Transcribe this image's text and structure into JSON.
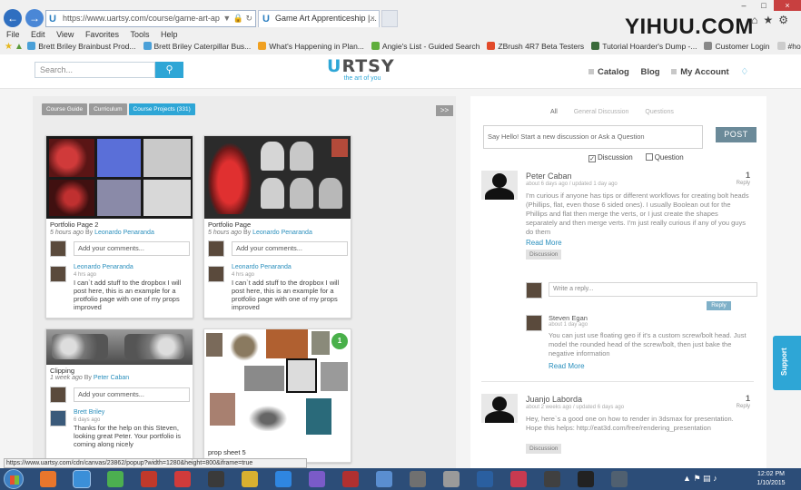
{
  "browser": {
    "address_url": "https://www.uartsy.com/course/game-art-ap",
    "tab_title": "Game Art Apprenticeship |...",
    "watermark": "YIHUU.COM",
    "window_controls": [
      "–",
      "□",
      "×"
    ],
    "menu": [
      "File",
      "Edit",
      "View",
      "Favorites",
      "Tools",
      "Help"
    ],
    "favorites": [
      {
        "label": "Brett Briley Brainbust Prod...",
        "color": "#4aa0d8"
      },
      {
        "label": "Brett Briley Caterpillar Bus...",
        "color": "#4aa0d8"
      },
      {
        "label": "What's Happening in Plan...",
        "color": "#f0a020"
      },
      {
        "label": "Angie's List - Guided Search",
        "color": "#5fae3c"
      },
      {
        "label": "ZBrush 4R7 Beta Testers",
        "color": "#e24a2a"
      },
      {
        "label": "Tutorial Hoarder's Dump -...",
        "color": "#3a6b3a"
      },
      {
        "label": "Customer Login",
        "color": "#888888"
      },
      {
        "label": "#home-",
        "color": "#cccccc"
      }
    ]
  },
  "header": {
    "search_placeholder": "Search...",
    "logo_part1": "U",
    "logo_part2": "RTSY",
    "logo_tagline": "the art of you",
    "nav": [
      "Catalog",
      "Blog",
      "My Account"
    ]
  },
  "course_tabs": {
    "items": [
      "Course Guide",
      "Curriculum",
      "Course Projects (331)"
    ],
    "active_index": 2,
    "collapse_label": ">>"
  },
  "cards": [
    {
      "title": "Portfolio Page 2",
      "time": "5 hours ago",
      "by": "By",
      "author": "Leonardo Penaranda",
      "comment_placeholder": "Add your comments...",
      "comment_author": "Leonardo Penaranda",
      "comment_time": "4 hrs ago",
      "comment_text": "I can`t add stuff to the dropbox I will post here, this is an example for a protfolio page with one of my props improved"
    },
    {
      "title": "Portfolio Page",
      "time": "5 hours ago",
      "by": "By",
      "author": "Leonardo Penaranda",
      "comment_placeholder": "Add your comments...",
      "comment_author": "Leonardo Penaranda",
      "comment_time": "4 hrs ago",
      "comment_text": "I can`t add stuff to the dropbox I will post here, this is an example for a protfolio page with one of my props improved"
    },
    {
      "title": "Clipping",
      "time": "1 week ago",
      "by": "By",
      "author": "Peter Caban",
      "comment_placeholder": "Add your comments...",
      "comment_author": "Brett Briley",
      "comment_time": "6 days ago",
      "comment_text": "Thanks for the help on this Steven, looking great Peter. Your portfolio is coming along nicely"
    },
    {
      "title": "prop sheet 5",
      "badge": "1"
    }
  ],
  "discussion": {
    "filters": [
      "All",
      "General Discussion",
      "Questions"
    ],
    "post_placeholder": "Say Hello! Start a new discussion or Ask a Question",
    "post_button": "POST",
    "type_options": [
      "Discussion",
      "Question"
    ],
    "threads": [
      {
        "name": "Peter Caban",
        "time": "about 6 days ago / updated 1 day ago",
        "count": "1",
        "count_label": "Reply",
        "text": "I'm curious if anyone has tips or different workflows for creating bolt heads (Phillips, flat, even those 6 sided ones). I usually Boolean out for the Phillips and flat then merge the verts, or I just create the shapes separately and then merge verts. I'm just really curious if any of you guys do them",
        "read_more": "Read More",
        "tag": "Discussion",
        "reply_placeholder": "Write a reply...",
        "reply_button": "Reply",
        "reply": {
          "name": "Steven Egan",
          "time": "about 1 day ago",
          "text": "You can just use floating geo if it's a custom screw/bolt head. Just model the rounded head of the screw/bolt, then just bake the negative information",
          "read_more": "Read More"
        }
      },
      {
        "name": "Juanjo Laborda",
        "time": "about 2 weeks ago / updated 6 days ago",
        "count": "1",
        "count_label": "Reply",
        "text": "Hey, here`s a good one on how to render in 3dsmax for presentation. Hope this helps: http://eat3d.com/free/rendering_presentation",
        "tag": "Discussion"
      }
    ]
  },
  "support_label": "Support",
  "status_url": "https://www.uartsy.com/cdn/canvas/23862/popup?width=1280&height=800&iframe=true",
  "taskbar": {
    "icons": [
      {
        "name": "firefox",
        "color": "#e8762c"
      },
      {
        "name": "internet-explorer",
        "color": "#3b8fd8"
      },
      {
        "name": "chrome",
        "color": "#4caf50"
      },
      {
        "name": "filezilla",
        "color": "#c0392b"
      },
      {
        "name": "opera",
        "color": "#d03b3b"
      },
      {
        "name": "app-dark",
        "color": "#3a3a3a"
      },
      {
        "name": "app-yellow",
        "color": "#d8b030"
      },
      {
        "name": "dropbox",
        "color": "#2f86e0"
      },
      {
        "name": "app-purple",
        "color": "#7a5bc8"
      },
      {
        "name": "app-red",
        "color": "#b03030"
      },
      {
        "name": "monitor",
        "color": "#5a8ed0"
      },
      {
        "name": "app-gray",
        "color": "#707070"
      },
      {
        "name": "zbrush",
        "color": "#9a9a9a"
      },
      {
        "name": "photoshop",
        "color": "#2a5fa0"
      },
      {
        "name": "app-pinkred",
        "color": "#c83a50"
      },
      {
        "name": "app-dark2",
        "color": "#404040"
      },
      {
        "name": "app-black",
        "color": "#222222"
      },
      {
        "name": "app-circle",
        "color": "#506070"
      }
    ],
    "time": "12:02 PM",
    "date": "1/10/2015"
  }
}
